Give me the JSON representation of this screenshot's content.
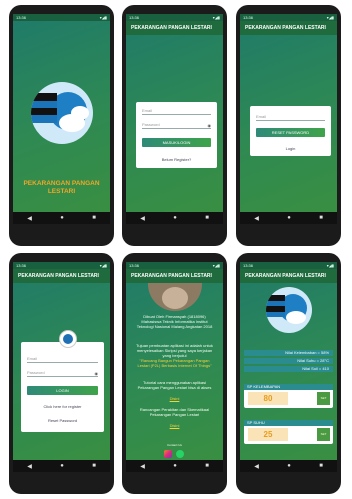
{
  "status": {
    "time": "13:36",
    "icons": "▾◢▮"
  },
  "app_title": "PEKARANGAN PANGAN LESTARI",
  "splash": {
    "title_line1": "PEKARANGAN PANGAN",
    "title_line2": "LESTARI"
  },
  "login": {
    "email_placeholder": "Email",
    "password_placeholder": "Password",
    "button": "MASUK/LOGIN",
    "register_link": "Belum Register?"
  },
  "reset": {
    "email_placeholder": "Email",
    "button": "RESET PASSWORD",
    "login_link": "Login"
  },
  "login2": {
    "email_placeholder": "Email",
    "password_placeholder": "Password",
    "button": "LOGIN",
    "register_link": "Click here for register",
    "reset_link": "Reset Password"
  },
  "about": {
    "p1": "Dibuat Oleh Firmansyah (1818096) Mahasiswa Teknik Informatika Institut Teknologi Nasional Malang Angkatan 2018",
    "p2a": "Tujuan pembuatan aplikasi ini adalah untuk menyelesaikan Skripsi yang saya kerjakan yang berjudul",
    "p2b": "\"Rancang Bangun Pekarangan Pangan Lestari (P2L) Berbasis Internet Of Things\"",
    "p3": "Tutorial cara menggunakan aplikasi Pekarangan Pangan Lestari bisa di akses",
    "p3_link": "Disini",
    "p4": "Rancangan Perakitan dan Skematikaal Pekarangan Pangan Lestari",
    "p4_link": "Disini",
    "footer": "Contact Us"
  },
  "dashboard": {
    "line1": "Nilai Kelembaban = 58%",
    "line2": "Nilai Suhu = 28°C",
    "line3": "Nilai Soil = 410",
    "card1_title": "SP KELEMBAPAN",
    "card1_value": "80",
    "card1_btn": "SET",
    "card2_title": "SP SUHU",
    "card2_value": "25",
    "card2_btn": "SET"
  },
  "nav": {
    "back": "◀",
    "home": "●",
    "recent": "■"
  }
}
